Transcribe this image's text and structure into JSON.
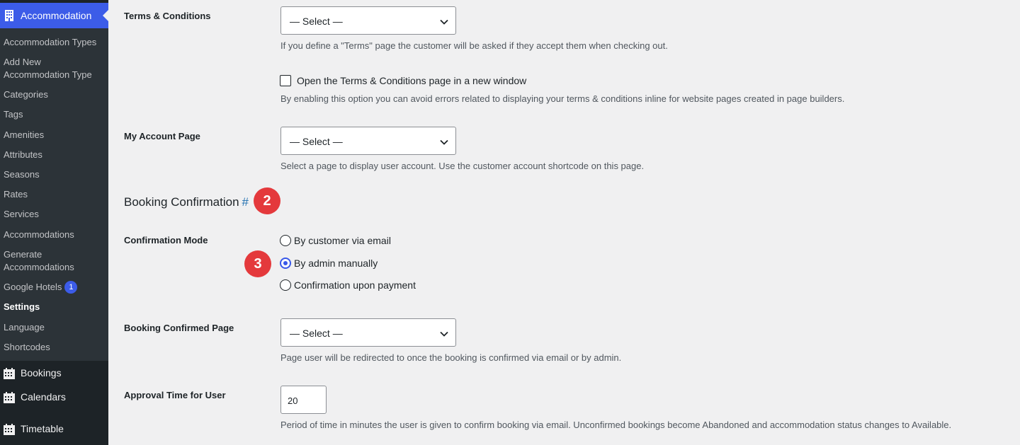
{
  "sidebar": {
    "active_menu": {
      "label": "Accommodation",
      "icon": "building-icon"
    },
    "sub_items": [
      {
        "label": "Accommodation Types"
      },
      {
        "label": "Add New"
      },
      {
        "label": "Accommodation Type"
      },
      {
        "label": "Categories"
      },
      {
        "label": "Tags"
      },
      {
        "label": "Amenities"
      },
      {
        "label": "Attributes"
      },
      {
        "label": "Seasons"
      },
      {
        "label": "Rates"
      },
      {
        "label": "Services"
      },
      {
        "label": "Accommodations"
      },
      {
        "label": "Generate"
      },
      {
        "label": "Accommodations"
      },
      {
        "label": "Google Hotels",
        "badge": "1"
      },
      {
        "label": "Settings"
      },
      {
        "label": "Language"
      },
      {
        "label": "Shortcodes"
      }
    ],
    "main_items": [
      {
        "label": "Bookings",
        "icon": "calendar-icon"
      },
      {
        "label": "Calendars",
        "icon": "calendar-icon"
      },
      {
        "label": "Timetable",
        "icon": "calendar-icon"
      }
    ]
  },
  "settings": {
    "terms": {
      "label": "Terms & Conditions",
      "select_value": "— Select —",
      "description": "If you define a \"Terms\" page the customer will be asked if they accept them when checking out.",
      "checkbox_label": "Open the Terms & Conditions page in a new window",
      "checkbox_checked": false,
      "checkbox_description": "By enabling this option you can avoid errors related to displaying your terms & conditions inline for website pages created in page builders."
    },
    "account": {
      "label": "My Account Page",
      "select_value": "— Select —",
      "description": "Select a page to display user account. Use the customer account shortcode on this page."
    },
    "booking_confirmation": {
      "title": "Booking Confirmation",
      "anchor": "#"
    },
    "confirmation_mode": {
      "label": "Confirmation Mode",
      "options": [
        "By customer via email",
        "By admin manually",
        "Confirmation upon payment"
      ],
      "selected": "By admin manually"
    },
    "confirmed_page": {
      "label": "Booking Confirmed Page",
      "select_value": "— Select —",
      "description": "Page user will be redirected to once the booking is confirmed via email or by admin."
    },
    "approval_time": {
      "label": "Approval Time for User",
      "value": "20",
      "description": "Period of time in minutes the user is given to confirm booking via email. Unconfirmed bookings become Abandoned and accommodation status changes to Available."
    }
  },
  "markers": [
    "2",
    "3"
  ],
  "colors": {
    "accent": "#3858e9",
    "sidebar_bg": "#1d2327",
    "marker": "#e4393c"
  }
}
